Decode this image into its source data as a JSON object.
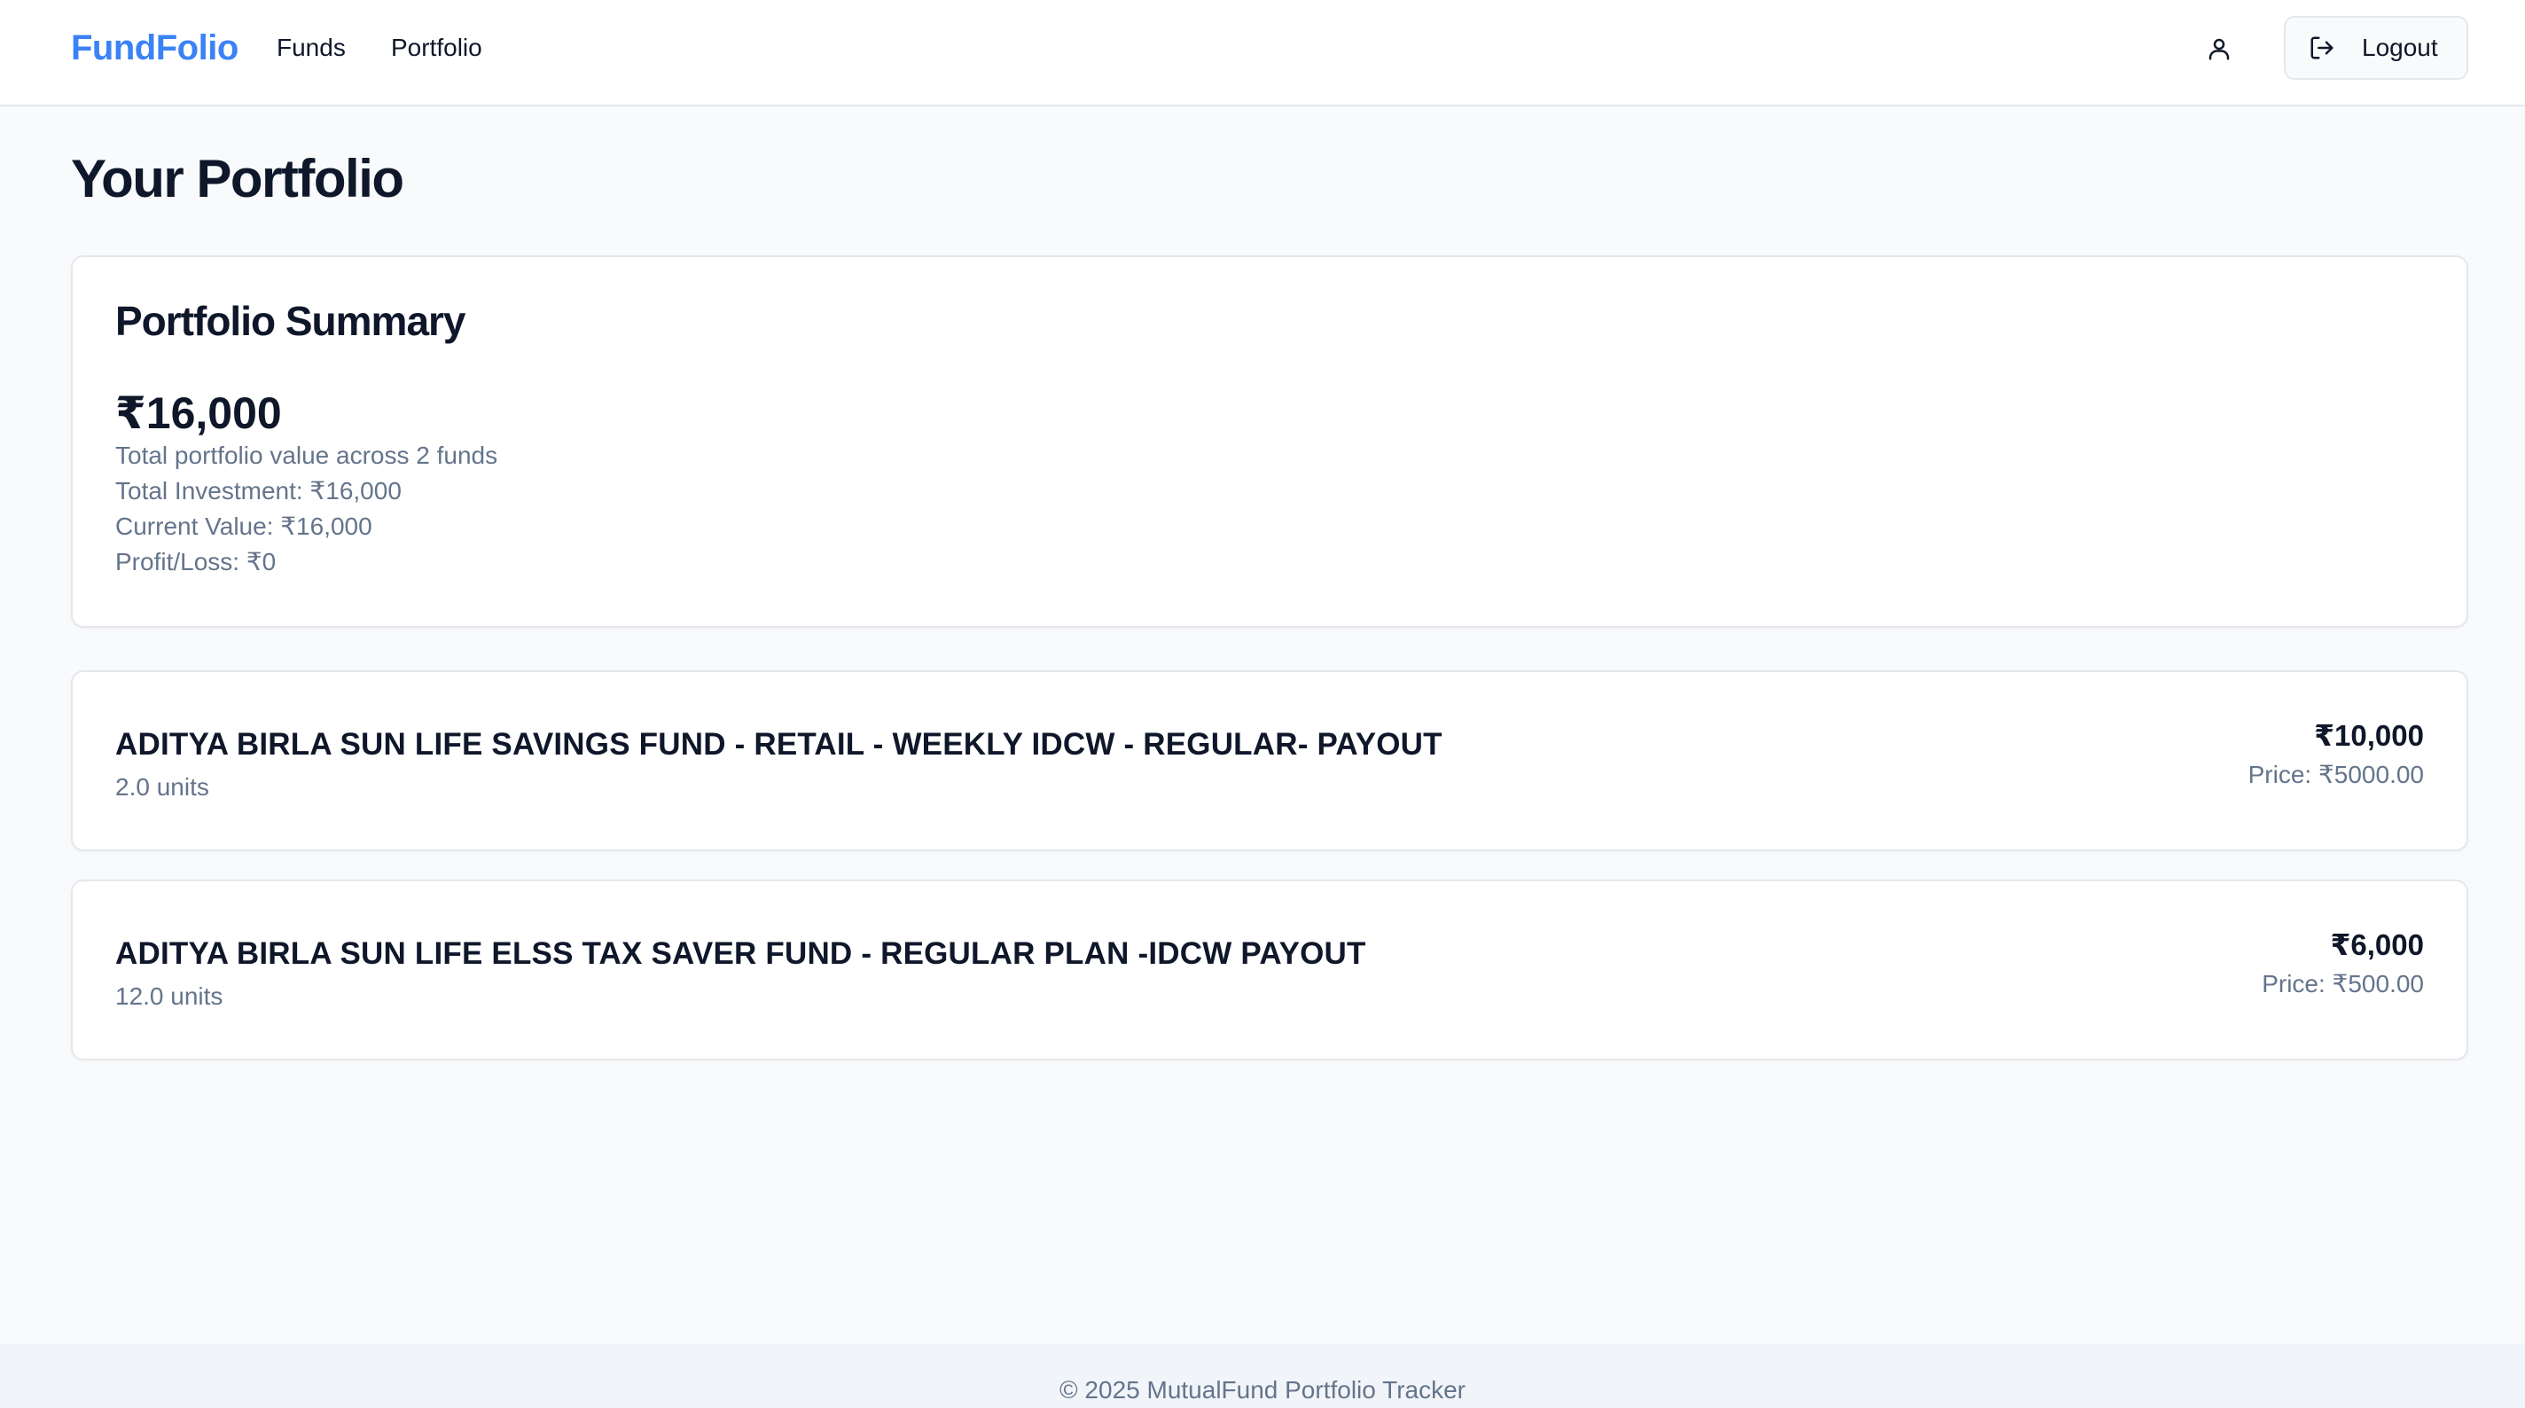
{
  "header": {
    "brand": "FundFolio",
    "nav": [
      {
        "label": "Funds"
      },
      {
        "label": "Portfolio"
      }
    ],
    "user_icon": "user-icon",
    "logout": {
      "label": "Logout",
      "icon": "logout-icon"
    }
  },
  "page": {
    "title": "Your Portfolio"
  },
  "summary": {
    "title": "Portfolio Summary",
    "total": "₹16,000",
    "description": "Total portfolio value across 2 funds",
    "total_investment": "Total Investment: ₹16,000",
    "current_value": "Current Value: ₹16,000",
    "profit_loss": "Profit/Loss: ₹0"
  },
  "holdings": [
    {
      "name": "ADITYA BIRLA SUN LIFE SAVINGS FUND - RETAIL - WEEKLY IDCW - REGULAR- PAYOUT",
      "units": "2.0 units",
      "value": "₹10,000",
      "price": "Price: ₹5000.00"
    },
    {
      "name": "ADITYA BIRLA SUN LIFE ELSS TAX SAVER FUND - REGULAR PLAN -IDCW PAYOUT",
      "units": "12.0 units",
      "value": "₹6,000",
      "price": "Price: ₹500.00"
    }
  ],
  "footer": {
    "text": "© 2025 MutualFund Portfolio Tracker"
  },
  "colors": {
    "brand": "#3b82f6",
    "text": "#0f172a",
    "muted": "#64748b",
    "background": "#f8fafc",
    "border": "#e5e7eb"
  }
}
